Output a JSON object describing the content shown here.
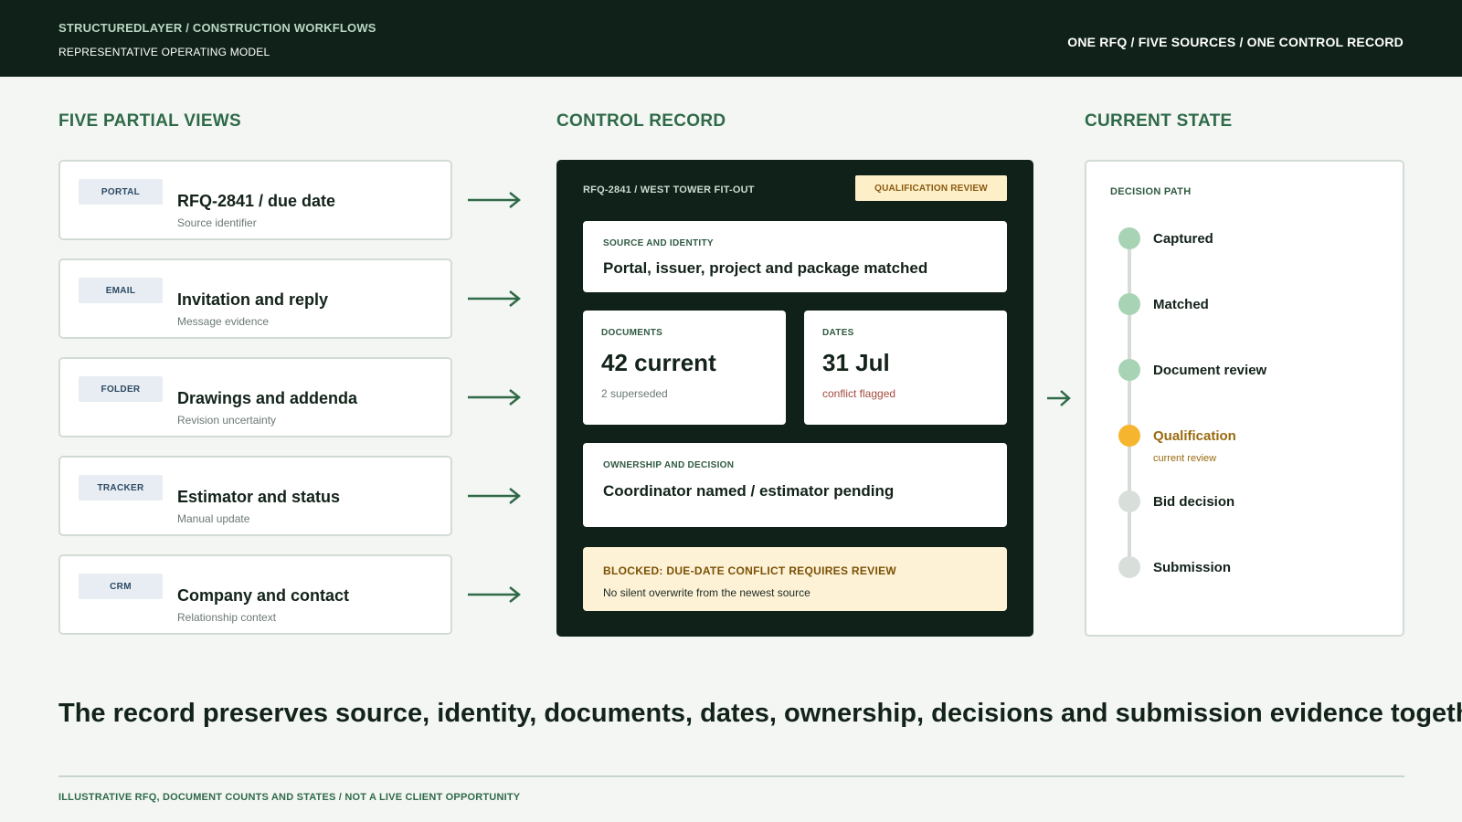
{
  "header": {
    "brand": "STRUCTUREDLAYER / CONSTRUCTION WORKFLOWS",
    "subtitle": "REPRESENTATIVE OPERATING MODEL",
    "tagline": "ONE RFQ / FIVE SOURCES / ONE CONTROL RECORD"
  },
  "sections": {
    "sources": "FIVE PARTIAL VIEWS",
    "control": "CONTROL RECORD",
    "state": "CURRENT STATE"
  },
  "sources": [
    {
      "tag": "PORTAL",
      "title": "RFQ-2841 / due date",
      "subtitle": "Source identifier"
    },
    {
      "tag": "EMAIL",
      "title": "Invitation and reply",
      "subtitle": "Message evidence"
    },
    {
      "tag": "FOLDER",
      "title": "Drawings and addenda",
      "subtitle": "Revision uncertainty"
    },
    {
      "tag": "TRACKER",
      "title": "Estimator and status",
      "subtitle": "Manual update"
    },
    {
      "tag": "CRM",
      "title": "Company and contact",
      "subtitle": "Relationship context"
    }
  ],
  "control": {
    "title": "RFQ-2841 / WEST TOWER FIT-OUT",
    "badge": "QUALIFICATION REVIEW",
    "identity": {
      "label": "SOURCE AND IDENTITY",
      "value": "Portal, issuer, project and package matched"
    },
    "documents": {
      "label": "DOCUMENTS",
      "value": "42 current",
      "note": "2 superseded"
    },
    "dates": {
      "label": "DATES",
      "value": "31 Jul",
      "note": "conflict flagged"
    },
    "ownership": {
      "label": "OWNERSHIP AND DECISION",
      "value": "Coordinator named / estimator pending"
    },
    "blocked": {
      "title": "BLOCKED: DUE-DATE CONFLICT REQUIRES REVIEW",
      "subtitle": "No silent overwrite from the newest source"
    }
  },
  "state": {
    "label": "DECISION PATH",
    "steps": [
      {
        "label": "Captured",
        "status": "done"
      },
      {
        "label": "Matched",
        "status": "done"
      },
      {
        "label": "Document review",
        "status": "done"
      },
      {
        "label": "Qualification",
        "status": "current",
        "note": "current review"
      },
      {
        "label": "Bid decision",
        "status": "pending"
      },
      {
        "label": "Submission",
        "status": "pending"
      }
    ]
  },
  "colors": {
    "done": "#a9d3b5",
    "current": "#f6b52e",
    "pending": "#d8dfdb",
    "dark": "#0f2119",
    "accent": "#2f6a48"
  },
  "statement": "The record preserves source, identity, documents, dates, ownership, decisions and submission evidence together.",
  "footnote": "ILLUSTRATIVE RFQ, DOCUMENT COUNTS AND STATES / NOT A LIVE CLIENT OPPORTUNITY"
}
